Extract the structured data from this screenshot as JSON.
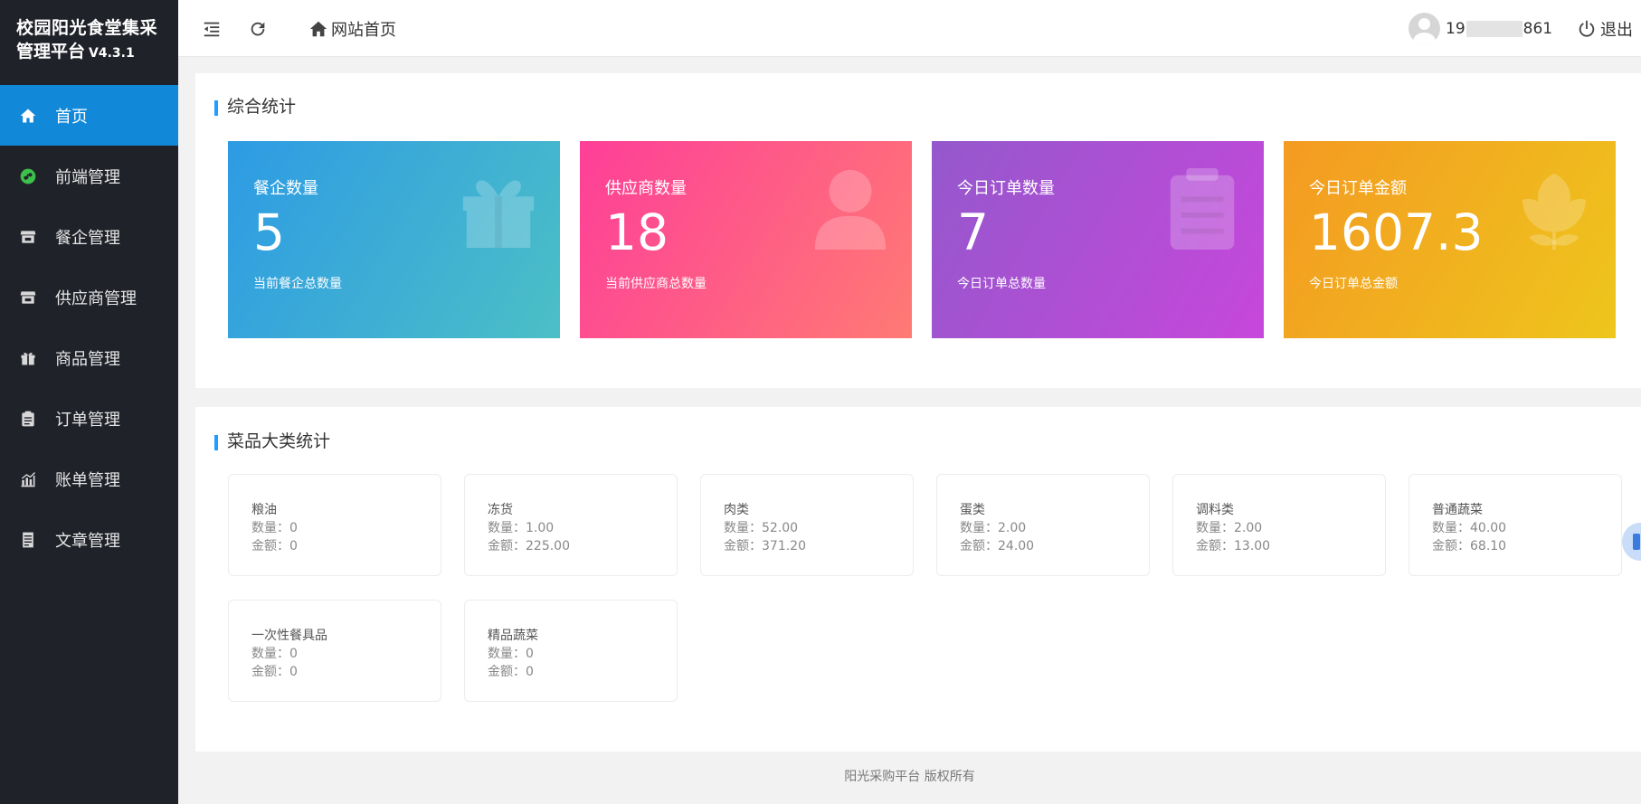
{
  "app": {
    "title_line1": "校园阳光食堂集采",
    "title_line2": "管理平台",
    "version": "V4.3.1"
  },
  "sidebar": {
    "items": [
      {
        "label": "首页",
        "icon": "home-icon",
        "active": true
      },
      {
        "label": "前端管理",
        "icon": "mini-program-icon",
        "active": false
      },
      {
        "label": "餐企管理",
        "icon": "store-icon",
        "active": false
      },
      {
        "label": "供应商管理",
        "icon": "store-icon",
        "active": false
      },
      {
        "label": "商品管理",
        "icon": "gift-icon",
        "active": false
      },
      {
        "label": "订单管理",
        "icon": "clipboard-icon",
        "active": false
      },
      {
        "label": "账单管理",
        "icon": "chart-icon",
        "active": false
      },
      {
        "label": "文章管理",
        "icon": "document-icon",
        "active": false
      }
    ]
  },
  "header": {
    "home_label": "网站首页",
    "user_prefix": "19",
    "user_suffix": "861",
    "logout_label": "退出"
  },
  "stats": {
    "title": "综合统计",
    "cards": [
      {
        "title": "餐企数量",
        "value": "5",
        "desc": "当前餐企总数量",
        "icon": "gift-icon",
        "gradient_from": "#2d9be4",
        "gradient_to": "#4cbfc6"
      },
      {
        "title": "供应商数量",
        "value": "18",
        "desc": "当前供应商总数量",
        "icon": "user-icon",
        "gradient_from": "#fe3f98",
        "gradient_to": "#ff7a74"
      },
      {
        "title": "今日订单数量",
        "value": "7",
        "desc": "今日订单总数量",
        "icon": "clipboard-icon",
        "gradient_from": "#9458cc",
        "gradient_to": "#c747db"
      },
      {
        "title": "今日订单金额",
        "value": "1607.3",
        "desc": "今日订单总金额",
        "icon": "flower-icon",
        "gradient_from": "#f49a22",
        "gradient_to": "#eec61c"
      }
    ]
  },
  "categories": {
    "title": "菜品大类统计",
    "qty_label": "数量：",
    "amt_label": "金额：",
    "items": [
      {
        "name": "粮油",
        "qty": "0",
        "amount": "0"
      },
      {
        "name": "冻货",
        "qty": "1.00",
        "amount": "225.00"
      },
      {
        "name": "肉类",
        "qty": "52.00",
        "amount": "371.20"
      },
      {
        "name": "蛋类",
        "qty": "2.00",
        "amount": "24.00"
      },
      {
        "name": "调料类",
        "qty": "2.00",
        "amount": "13.00"
      },
      {
        "name": "普通蔬菜",
        "qty": "40.00",
        "amount": "68.10"
      },
      {
        "name": "一次性餐具品",
        "qty": "0",
        "amount": "0"
      },
      {
        "name": "精品蔬菜",
        "qty": "0",
        "amount": "0"
      }
    ]
  },
  "footer": {
    "text": "阳光采购平台  版权所有"
  }
}
